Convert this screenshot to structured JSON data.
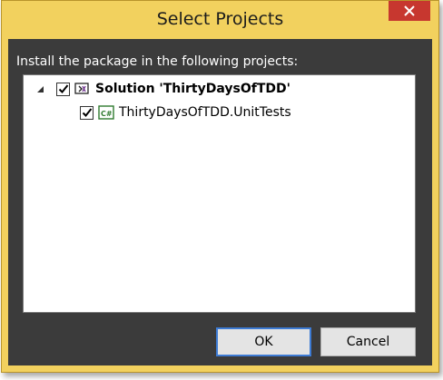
{
  "window": {
    "title": "Select Projects"
  },
  "instruction": "Install the package in the following projects:",
  "tree": {
    "root": {
      "label": "Solution 'ThirtyDaysOfTDD'",
      "checked": true,
      "expanded": true,
      "icon": "solution-icon"
    },
    "children": [
      {
        "label": "ThirtyDaysOfTDD.UnitTests",
        "checked": true,
        "icon": "csharp-project-icon"
      }
    ]
  },
  "buttons": {
    "ok": "OK",
    "cancel": "Cancel"
  },
  "colors": {
    "frame": "#f2d15e",
    "client": "#3b3b3b",
    "close": "#c7372f",
    "accent": "#3d7bd4"
  }
}
